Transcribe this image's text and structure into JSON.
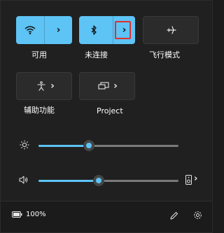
{
  "tiles": [
    {
      "label": "可用",
      "icon": "wifi-icon",
      "state": "on"
    },
    {
      "label": "未连接",
      "icon": "bluetooth-icon",
      "state": "on"
    },
    {
      "label": "飞行模式",
      "icon": "airplane-icon",
      "state": "off"
    },
    {
      "label": "辅助功能",
      "icon": "accessibility-icon",
      "state": "off"
    },
    {
      "label": "Project",
      "icon": "project-icon",
      "state": "off"
    }
  ],
  "sliders": {
    "brightness": {
      "icon": "brightness-icon",
      "level": 0.36
    },
    "volume": {
      "icon": "volume-icon",
      "level": 0.43,
      "device_icon": "speaker-icon"
    }
  },
  "footer": {
    "battery": "100%",
    "battery_icon": "battery-icon",
    "edit_icon": "pencil-icon",
    "settings_icon": "gear-icon"
  },
  "colors": {
    "accent": "#5ec3f5",
    "background": "#202020",
    "highlight": "#e02f2f"
  }
}
